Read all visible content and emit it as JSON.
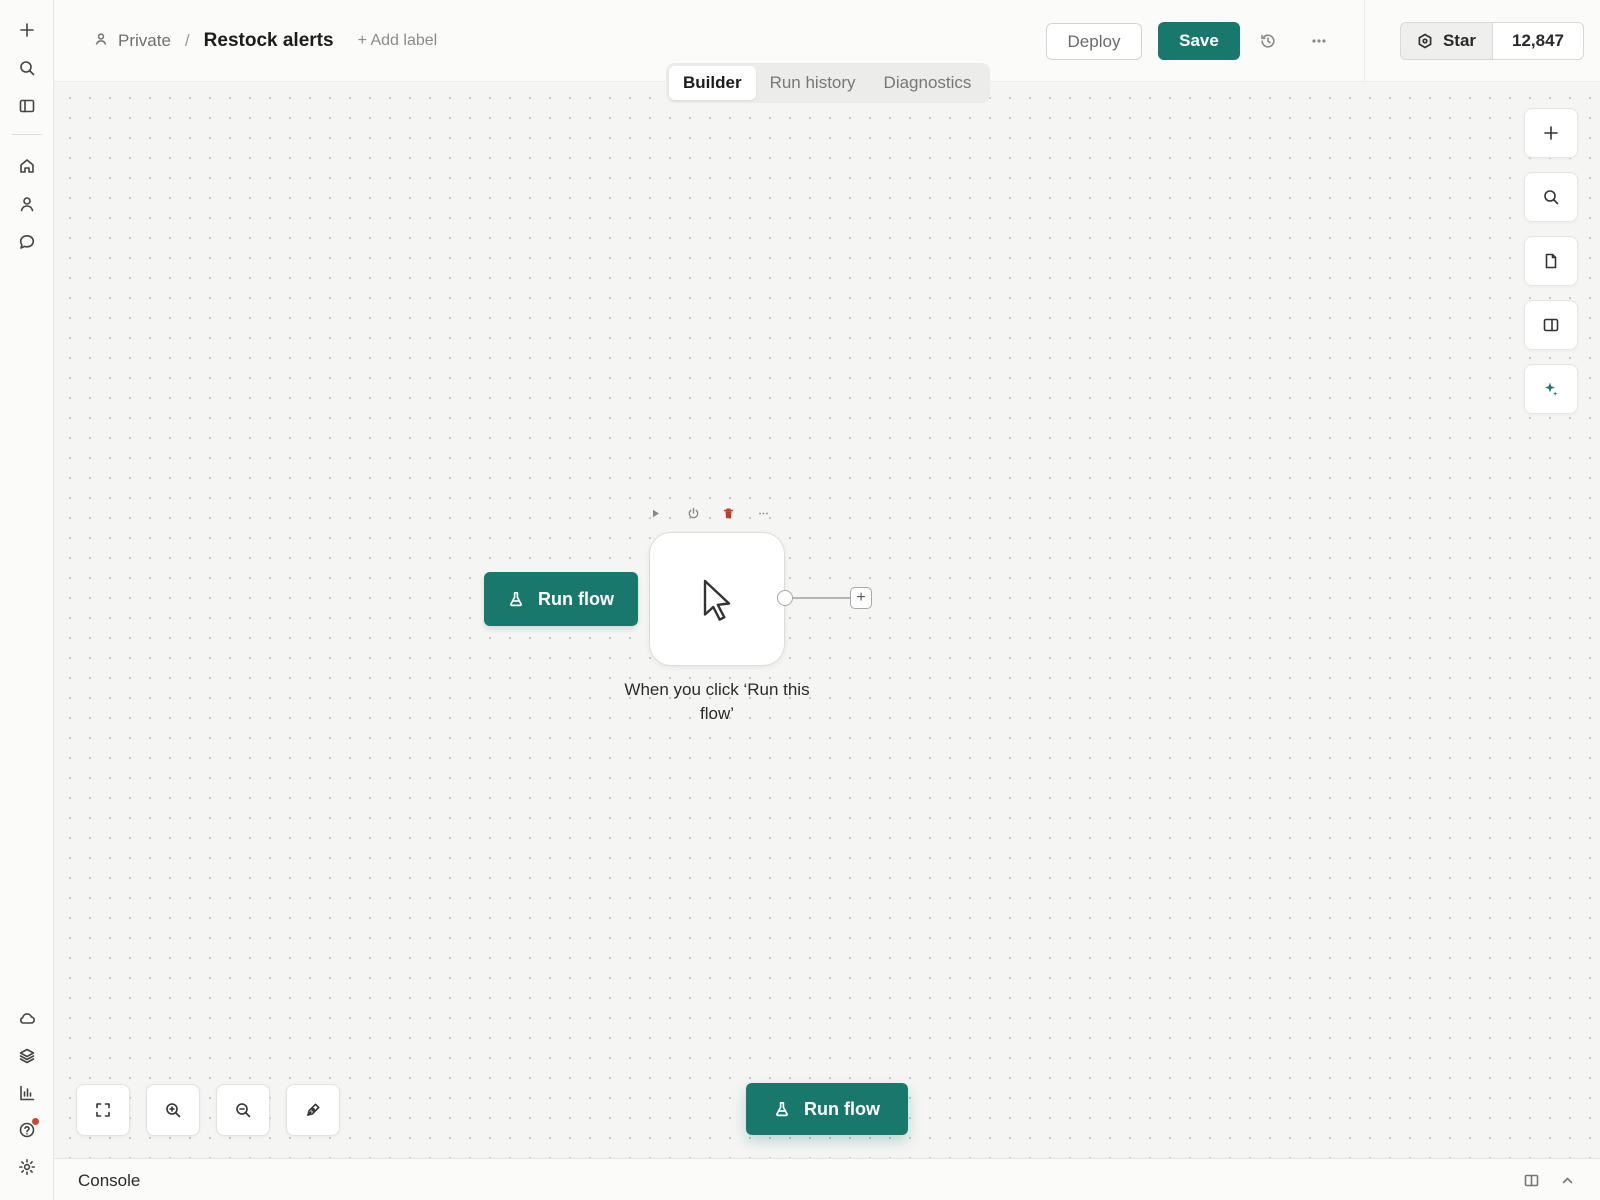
{
  "app": {
    "accent": "#19786c",
    "danger": "#c0392b"
  },
  "rail": {
    "top_items": [
      {
        "icon": "plus-icon"
      },
      {
        "icon": "search-icon"
      },
      {
        "icon": "panel-icon"
      }
    ],
    "nav_items": [
      {
        "icon": "home-icon"
      },
      {
        "icon": "user-icon"
      },
      {
        "icon": "chat-icon"
      }
    ],
    "bottom_items": [
      {
        "icon": "cloud-icon"
      },
      {
        "icon": "layers-icon"
      },
      {
        "icon": "bar-chart-icon"
      },
      {
        "icon": "help-icon",
        "has_notification": true
      },
      {
        "icon": "settings-icon"
      }
    ]
  },
  "header": {
    "breadcrumb": {
      "scope": "Private",
      "separator": "/",
      "title": "Restock alerts"
    },
    "add_label": "+ Add label",
    "deploy_label": "Deploy",
    "save_label": "Save",
    "star_label": "Star",
    "star_count": "12,847"
  },
  "tabs": [
    {
      "label": "Builder",
      "active": true
    },
    {
      "label": "Run history",
      "active": false
    },
    {
      "label": "Diagnostics",
      "active": false
    }
  ],
  "canvas": {
    "side_tools": [
      {
        "icon": "plus-icon"
      },
      {
        "icon": "search-icon"
      },
      {
        "icon": "document-icon"
      },
      {
        "icon": "split-panel-icon"
      },
      {
        "icon": "sparkle-icon"
      }
    ],
    "run_flow_node_label": "Run flow",
    "trigger_node": {
      "icon": "cursor-icon",
      "caption": "When you click ‘Run this flow’",
      "toolbar": [
        "play-icon",
        "power-icon",
        "trash-icon",
        "more-icon"
      ]
    },
    "bottom_tools": [
      {
        "icon": "fit-view-icon"
      },
      {
        "icon": "zoom-in-icon"
      },
      {
        "icon": "zoom-out-icon"
      },
      {
        "icon": "pen-icon"
      }
    ],
    "run_flow_button_label": "Run flow"
  },
  "console": {
    "label": "Console"
  }
}
